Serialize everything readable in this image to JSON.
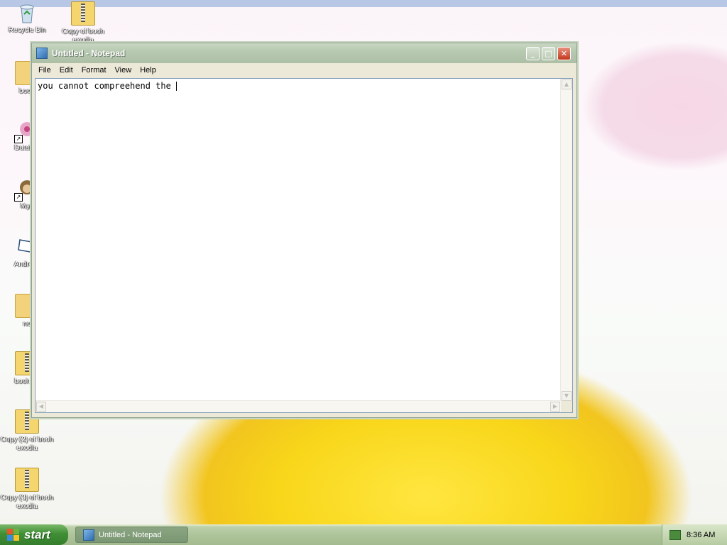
{
  "desktop": {
    "icons": [
      {
        "label": "Recycle Bin",
        "icon": "recycle-bin-icon"
      },
      {
        "label": "Copy of booh exodia",
        "icon": "zip-folder-icon"
      },
      {
        "label": "booh",
        "icon": "folder-icon"
      },
      {
        "label": "DataWa",
        "icon": "flower-shortcut-icon"
      },
      {
        "label": "Myp",
        "icon": "monkey-shortcut-icon"
      },
      {
        "label": "AndreiO",
        "icon": "file-icon"
      },
      {
        "label": "no",
        "icon": "folder-icon"
      },
      {
        "label": "booh ex",
        "icon": "zip-folder-icon"
      },
      {
        "label": "Copy (2) of booh exodia",
        "icon": "zip-folder-icon"
      },
      {
        "label": "Copy (3) of booh exodia",
        "icon": "zip-folder-icon"
      }
    ]
  },
  "window": {
    "title": "Untitled - Notepad",
    "buttons": {
      "minimize": "_",
      "maximize": "□",
      "close": "✕"
    },
    "menu": [
      "File",
      "Edit",
      "Format",
      "View",
      "Help"
    ],
    "text": "you cannot compreehend the "
  },
  "taskbar": {
    "start_label": "start",
    "task_label": "Untitled - Notepad",
    "clock": "8:36 AM"
  },
  "colors": {
    "taskbar": "#aec49a",
    "start": "#3f8f35",
    "title_bar": "#b7c9b1",
    "close": "#c4381f"
  }
}
